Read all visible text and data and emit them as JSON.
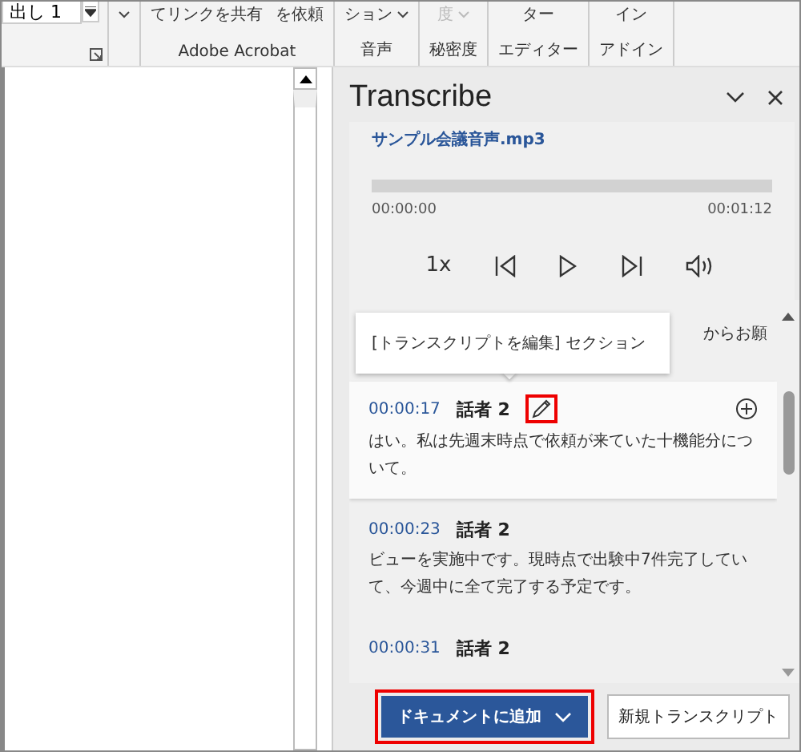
{
  "ribbon": {
    "style_box": "出し 1",
    "groups": [
      {
        "buttons": [
          {
            "dropdown": true,
            "disabled": false
          }
        ]
      },
      {
        "label": "Adobe Acrobat",
        "buttons": [
          {
            "text": "てリンクを共有",
            "dropdown": false,
            "disabled": false
          },
          {
            "text": "を依頼",
            "dropdown": false,
            "disabled": false
          }
        ]
      },
      {
        "label": "音声",
        "buttons": [
          {
            "text": "ション",
            "dropdown": true,
            "disabled": false
          }
        ]
      },
      {
        "label": "秘密度",
        "buttons": [
          {
            "text": "度",
            "dropdown": true,
            "disabled": true
          }
        ]
      },
      {
        "label": "エディター",
        "buttons": [
          {
            "text": "ター",
            "dropdown": false,
            "disabled": false
          }
        ]
      },
      {
        "label": "アドイン",
        "buttons": [
          {
            "text": "イン",
            "dropdown": false,
            "disabled": false
          }
        ]
      }
    ]
  },
  "panel": {
    "title": "Transcribe",
    "player": {
      "file": "サンプル会議音声.mp3",
      "start": "00:00:00",
      "end": "00:01:12",
      "speed": "1x"
    },
    "fragment": "からお願",
    "tooltip": "[トランスクリプトを編集] セクション",
    "segments": [
      {
        "time": "00:00:17",
        "speaker": "話者 2",
        "text": "はい。私は先週末時点で依頼が来ていた十機能分について。",
        "selected": true,
        "edit_highlighted": true
      },
      {
        "time": "00:00:23",
        "speaker": "話者 2",
        "text": "ビューを実施中です。現時点で出験中7件完了していて、今週中に全て完了する予定です。",
        "selected": false
      },
      {
        "time": "00:00:31",
        "speaker": "話者 2",
        "selected": false
      }
    ],
    "add_button": {
      "label": "ドキュメントに追加",
      "highlighted": true
    },
    "new_button": {
      "label": "新規トランスクリプト"
    }
  }
}
